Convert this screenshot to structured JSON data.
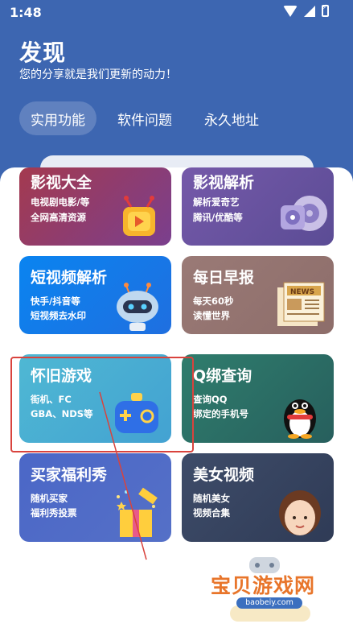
{
  "status_bar": {
    "time": "1:48"
  },
  "header": {
    "title": "发现",
    "subtitle": "您的分享就是我们更新的动力！"
  },
  "tabs": [
    {
      "label": "实用功能",
      "active": true
    },
    {
      "label": "软件问题",
      "active": false
    },
    {
      "label": "永久地址",
      "active": false
    }
  ],
  "cards": [
    {
      "title": "影视大全",
      "line1": "电视剧电影/等",
      "line2": "全网高清资源",
      "icon": "tv-play-icon"
    },
    {
      "title": "影视解析",
      "line1": "解析爱奇艺",
      "line2": "腾讯/优酷等",
      "icon": "film-reel-icon"
    },
    {
      "title": "短视频解析",
      "line1": "快手/抖音等",
      "line2": "短视频去水印",
      "icon": "robot-icon"
    },
    {
      "title": "每日早报",
      "line1": "每天60秒",
      "line2": "读懂世界",
      "icon": "newspaper-icon"
    },
    {
      "title": "怀旧游戏",
      "line1": "街机、FC",
      "line2": "GBA、NDS等",
      "icon": "gamepad-icon"
    },
    {
      "title": "Q绑查询",
      "line1": "查询QQ",
      "line2": "绑定的手机号",
      "icon": "qq-penguin-icon"
    },
    {
      "title": "买家福利秀",
      "line1": "随机买家",
      "line2": "福利秀投票",
      "icon": "gift-box-icon"
    },
    {
      "title": "美女视频",
      "line1": "随机美女",
      "line2": "视频合集",
      "icon": "girl-avatar-icon"
    }
  ],
  "watermark": {
    "text": "宝贝游戏网",
    "url": "baobeiy.com"
  }
}
